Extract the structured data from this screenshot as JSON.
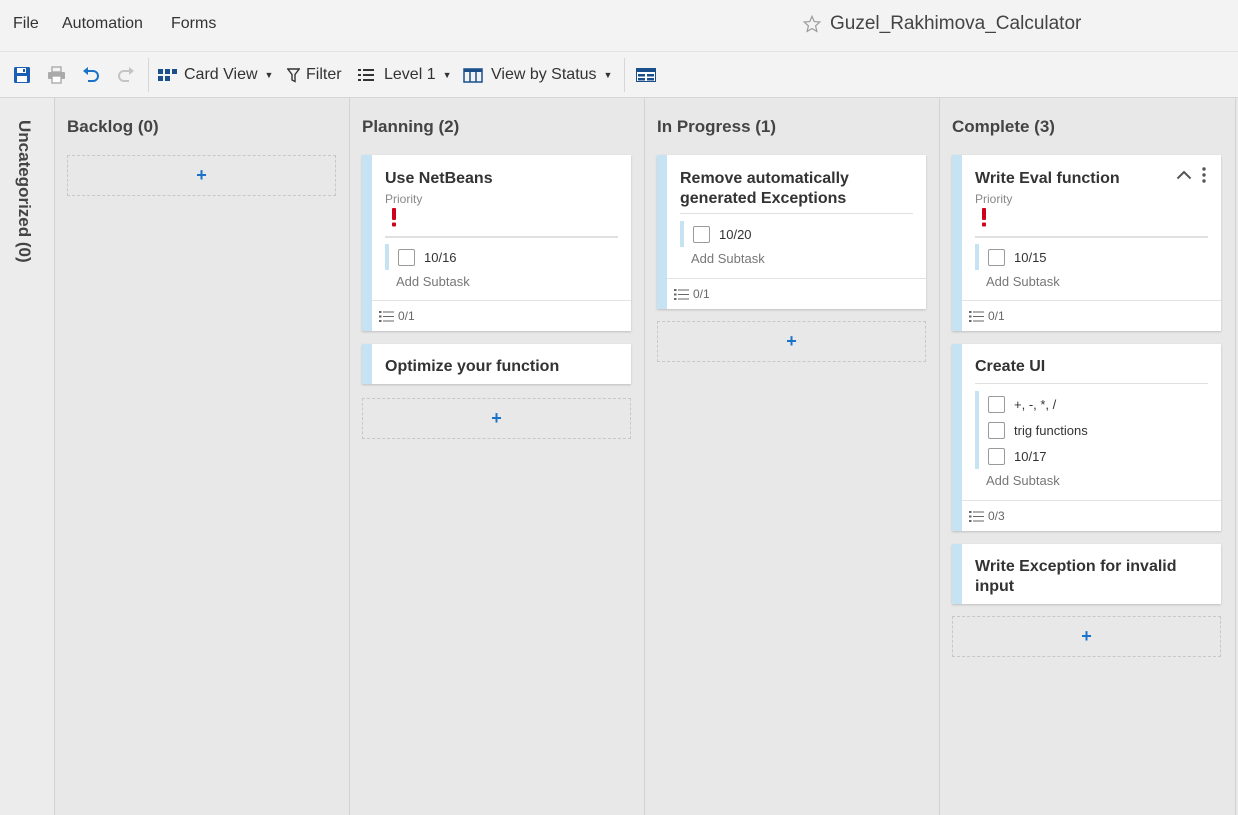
{
  "menu": {
    "file": "File",
    "automation": "Automation",
    "forms": "Forms",
    "sheet_title": "Guzel_Rakhimova_Calculator"
  },
  "toolbar": {
    "card_view": "Card View",
    "filter": "Filter",
    "level": "Level 1",
    "view_by": "View by Status"
  },
  "uncategorized": {
    "label": "Uncategorized (0)"
  },
  "lanes": [
    {
      "label": "Backlog (0)"
    },
    {
      "label": "Planning (2)"
    },
    {
      "label": "In Progress (1)"
    },
    {
      "label": "Complete (3)"
    }
  ],
  "cards": {
    "use_netbeans": {
      "title": "Use NetBeans",
      "priority_label": "Priority",
      "subtasks": [
        "10/16"
      ],
      "add_subtask": "Add Subtask",
      "subtask_count": "0/1"
    },
    "optimize": {
      "title": "Optimize your function"
    },
    "remove_exceptions": {
      "title": "Remove automatically generated Exceptions",
      "subtasks": [
        "10/20"
      ],
      "add_subtask": "Add Subtask",
      "subtask_count": "0/1"
    },
    "write_eval": {
      "title": "Write Eval function",
      "priority_label": "Priority",
      "subtasks": [
        "10/15"
      ],
      "add_subtask": "Add Subtask",
      "subtask_count": "0/1"
    },
    "create_ui": {
      "title": "Create UI",
      "subtasks": [
        "+, -, *, /",
        "trig functions",
        "10/17"
      ],
      "add_subtask": "Add Subtask",
      "subtask_count": "0/3"
    },
    "write_exception": {
      "title": "Write Exception for invalid input"
    }
  },
  "add_label": "+",
  "colors": {
    "accent": "#1a73c8",
    "card_stripe": "#c5e3f3",
    "priority": "#d0021b"
  },
  "icons": [
    "save-icon",
    "print-icon",
    "undo-icon",
    "redo-icon",
    "card-view-icon",
    "filter-icon",
    "level-list-icon",
    "columns-icon",
    "grid-view-icon",
    "star-icon",
    "priority-icon",
    "subtask-list-icon",
    "collapse-icon",
    "more-icon"
  ]
}
